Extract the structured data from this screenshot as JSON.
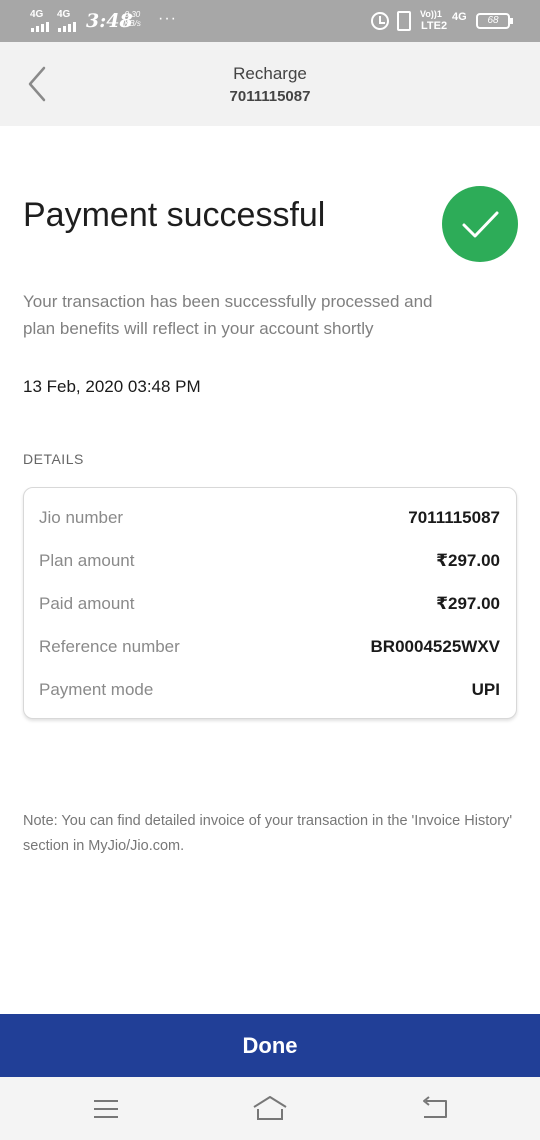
{
  "status_bar": {
    "sim1": "4G",
    "sim2": "4G",
    "time": "3:48",
    "speed_value": "0.30",
    "speed_unit": "KB/s",
    "more_dots": "···",
    "volte": "Vo))1",
    "lte": "LTE2",
    "network": "4G",
    "battery": "68"
  },
  "header": {
    "title": "Recharge",
    "number": "7011115087"
  },
  "main": {
    "title": "Payment successful",
    "description": "Your transaction has been successfully processed and plan benefits will reflect in your account shortly",
    "timestamp": "13 Feb, 2020 03:48 PM",
    "details_label": "DETAILS"
  },
  "details": [
    {
      "label": "Jio number",
      "value": "7011115087"
    },
    {
      "label": "Plan amount",
      "value": "₹297.00"
    },
    {
      "label": "Paid amount",
      "value": "₹297.00"
    },
    {
      "label": "Reference number",
      "value": "BR0004525WXV"
    },
    {
      "label": "Payment mode",
      "value": "UPI"
    }
  ],
  "note": "Note: You can find detailed invoice of your transaction in the 'Invoice History' section in MyJio/Jio.com.",
  "done_label": "Done",
  "colors": {
    "success": "#2dac58",
    "primary": "#213f97",
    "header_bg": "#f2f2f2",
    "status_bar_bg": "#a7a7a7"
  }
}
